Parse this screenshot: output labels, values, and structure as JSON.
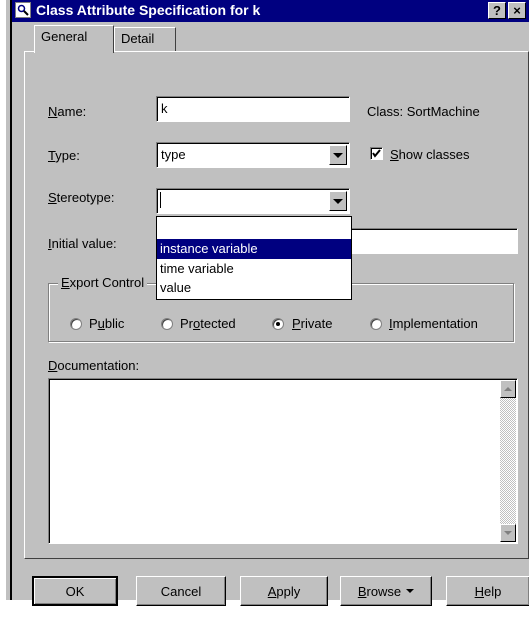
{
  "window": {
    "title": "Class Attribute Specification for k",
    "help_label": "?",
    "close_label": "×"
  },
  "tabs": [
    {
      "label": "General",
      "active": true
    },
    {
      "label": "Detail",
      "active": false
    }
  ],
  "form": {
    "name_label": "Name:",
    "name_value": "k",
    "class_label": "Class: SortMachine",
    "type_label": "Type:",
    "type_value": "type",
    "show_classes_label": "Show classes",
    "show_classes_checked": true,
    "stereotype_label": "Stereotype:",
    "stereotype_value": "",
    "initial_value_label": "Initial value:",
    "initial_value": ""
  },
  "stereotype_options": [
    "",
    "instance variable",
    "time variable",
    "value"
  ],
  "stereotype_highlighted": "instance variable",
  "export_control": {
    "label": "Export Control",
    "options": [
      "Public",
      "Protected",
      "Private",
      "Implementation"
    ],
    "selected": "Private"
  },
  "documentation": {
    "label": "Documentation:",
    "text": ""
  },
  "buttons": {
    "ok": "OK",
    "cancel": "Cancel",
    "apply": "Apply",
    "browse": "Browse",
    "help": "Help"
  },
  "colors": {
    "titlebar": "#000080",
    "face": "#c0c0c0",
    "highlight": "#000080"
  }
}
